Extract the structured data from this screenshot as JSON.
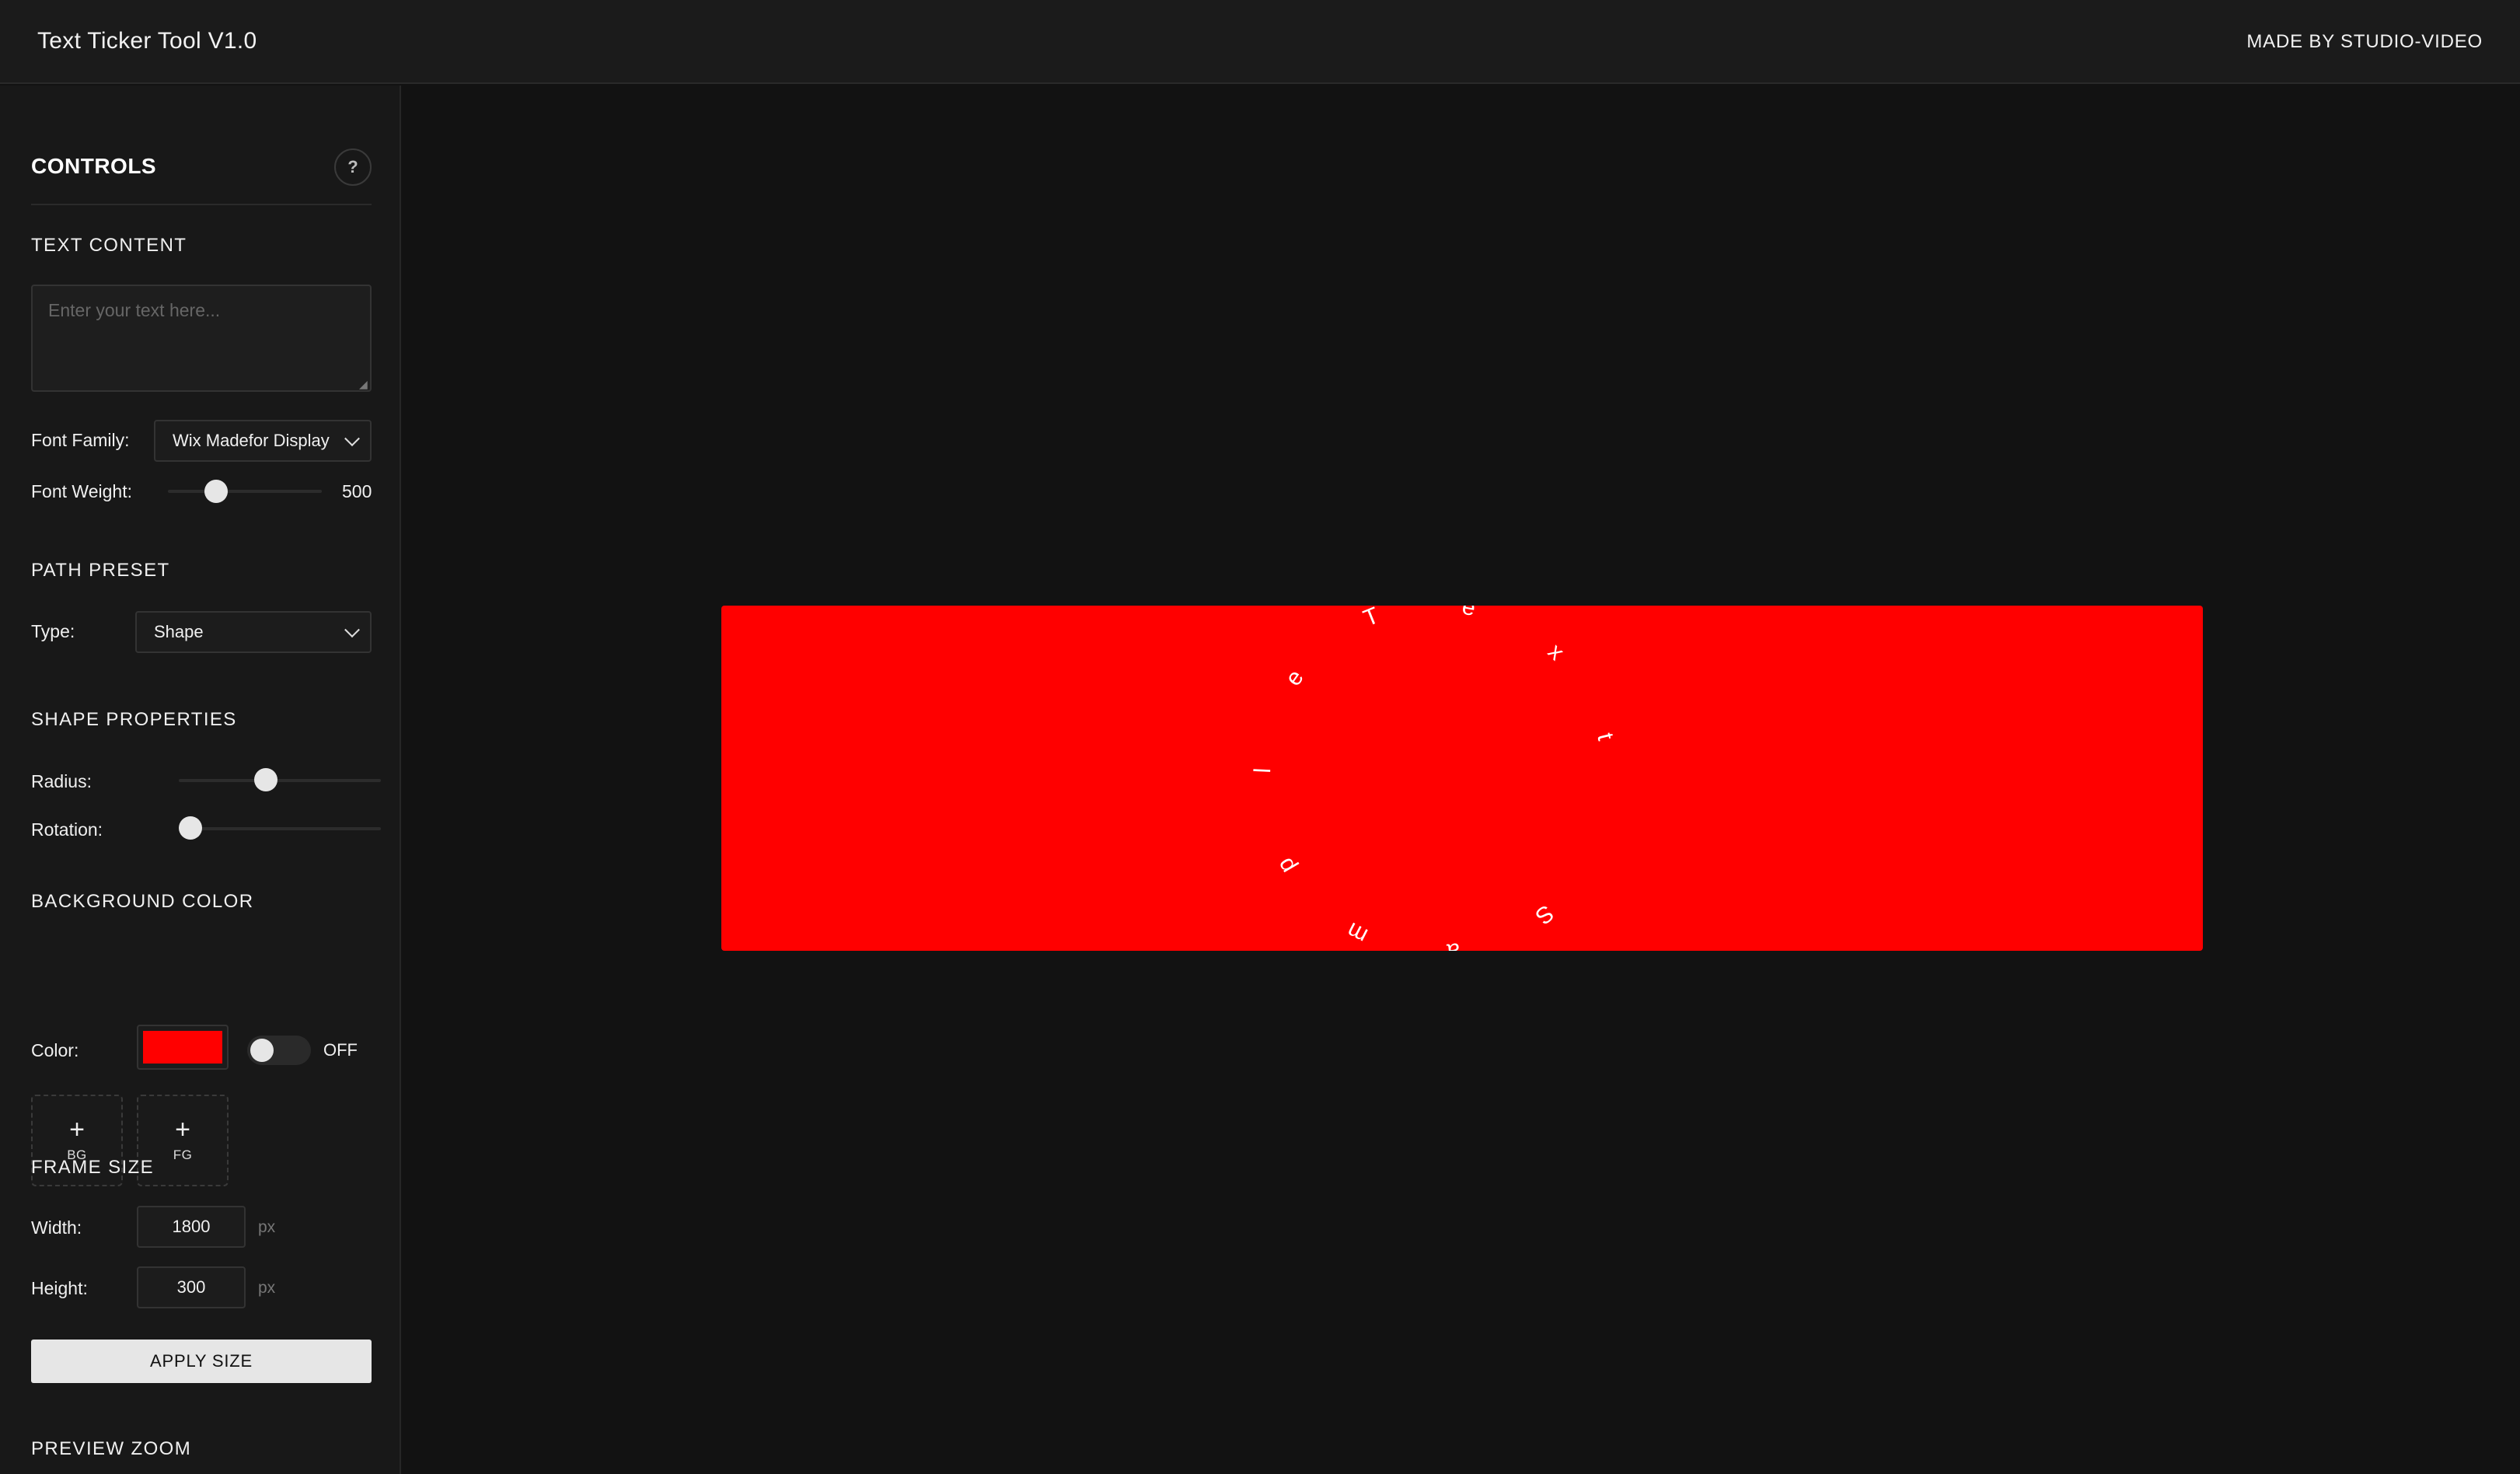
{
  "header": {
    "title": "Text Ticker Tool V1.0",
    "made_by": "MADE BY STUDIO-VIDEO"
  },
  "controls": {
    "title": "CONTROLS",
    "help_label": "?",
    "text_content": {
      "heading": "TEXT CONTENT",
      "value": "",
      "placeholder": "Enter your text here...",
      "font_family_label": "Font Family:",
      "font_family_value": "Wix Madefor Display",
      "font_weight_label": "Font Weight:",
      "font_weight_value": "500",
      "font_weight_fraction": 0.28
    },
    "path_preset": {
      "heading": "PATH PRESET",
      "type_label": "Type:",
      "type_value": "Shape"
    },
    "shape_properties": {
      "heading": "SHAPE PROPERTIES",
      "radius_label": "Radius:",
      "radius_fraction": 0.42,
      "rotation_label": "Rotation:",
      "rotation_fraction": 0.0
    },
    "background_color": {
      "heading": "BACKGROUND COLOR",
      "color_label": "Color:",
      "color_value": "#ff0000",
      "toggle_label": "OFF",
      "toggle_on": false,
      "bg_tile_label": "BG",
      "fg_tile_label": "FG",
      "plus_symbol": "+"
    },
    "frame_size": {
      "heading": "FRAME SIZE",
      "width_label": "Width:",
      "width_value": "1800",
      "height_label": "Height:",
      "height_value": "300",
      "unit": "px",
      "apply_label": "APPLY SIZE"
    },
    "preview_zoom": {
      "heading": "PREVIEW ZOOM"
    }
  },
  "preview": {
    "background": "#ff0000",
    "text_color": "#ffffff",
    "circle_text": "Text Sample"
  }
}
